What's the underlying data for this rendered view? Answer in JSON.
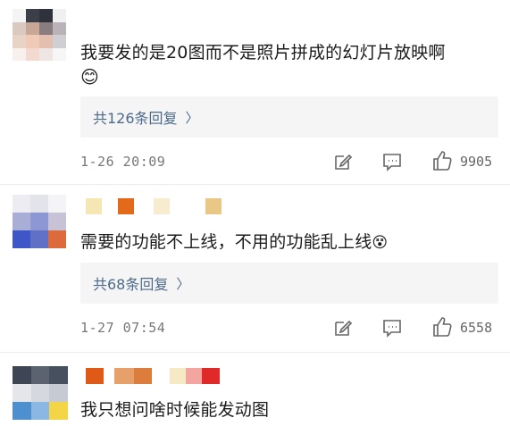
{
  "comments": [
    {
      "text": "我要发的是20图而不是照片拼成的幻灯片放映啊",
      "emoji": "😊",
      "replies_label": "共126条回复",
      "time": "1-26 20:09",
      "likes": "9905"
    },
    {
      "text": "需要的功能不上线，不用的功能乱上线",
      "emoji": "😵",
      "replies_label": "共68条回复",
      "time": "1-27 07:54",
      "likes": "6558"
    },
    {
      "text": "我只想问啥时候能发动图"
    }
  ],
  "icons": {
    "edit": "edit-icon",
    "comment": "comment-icon",
    "like": "thumbs-up-icon",
    "chevron": "chevron-right-icon"
  },
  "chevron_glyph": "〉"
}
